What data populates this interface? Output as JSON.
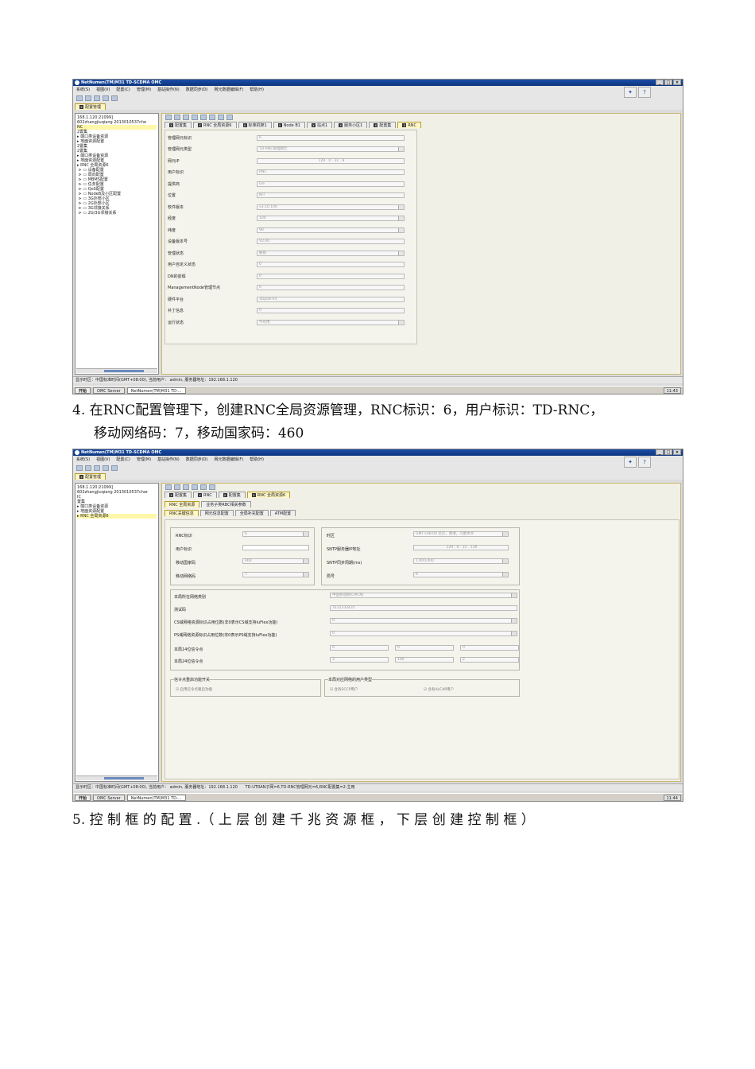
{
  "common": {
    "app_title": "NetNumen(TM)M31 TD-SCDMA OMC",
    "menu": [
      "系统(S)",
      "视图(V)",
      "配置(C)",
      "管理(M)",
      "基站操作(N)",
      "数据同步(D)",
      "网元数据编辑(F)",
      "帮助(H)"
    ],
    "window_buttons": [
      "_",
      "□",
      "×"
    ],
    "config_tab": "配置管理",
    "start": "开始",
    "taskbar_server": "OMC Server",
    "taskbar_app": "NetNumen(TM)M31 TD-...",
    "status_prefix": "显示时区：中国标准时间(GMT+08:00), 当前用户： admin, 服务器地址：192.168.1.120"
  },
  "shot1": {
    "tabs": [
      "配置集",
      "RNC 全局资源6",
      "标准机架1",
      "Node B1",
      "站点1",
      "服务小区1",
      "配置集",
      "RNC"
    ],
    "tree": [
      "168.1.120:21099]",
      "602zhangjiuqiang 2013010537che",
      "NC",
      "2置集",
      "端口类设备资源",
      "地面资源配置",
      "2置集",
      "2置集",
      "端口类设备资源",
      "地面资源配置",
      "RNC 全局资源6",
      "设备配置",
      "局向配置",
      "MBMS配置",
      "任务配置",
      "QoS配置",
      "NodeB及小区配置",
      "3G外部小区",
      "2G外部小区",
      "3G邻接关系",
      "2G/3G邻接关系"
    ],
    "fields": [
      {
        "label": "管理网元标识",
        "value": "6"
      },
      {
        "label": "管理网元类型",
        "value": "TD-RNC管理网元"
      },
      {
        "label": "网元IP",
        "value": "129 . 0 . 31 . 8"
      },
      {
        "label": "用户标识",
        "value": "RNC"
      },
      {
        "label": "提供商",
        "value": "Ele"
      },
      {
        "label": "位置",
        "value": "NIT"
      },
      {
        "label": "软件版本",
        "value": "v3.10.100"
      },
      {
        "label": "经度",
        "value": "100"
      },
      {
        "label": "纬度",
        "value": "90"
      },
      {
        "label": "设备版本号",
        "value": "V2.00"
      },
      {
        "label": "管理状态",
        "value": "解锁"
      },
      {
        "label": "用户自定义状态",
        "value": "0"
      },
      {
        "label": "DN的前缀",
        "value": "0"
      },
      {
        "label": "ManagementNode管理节点",
        "value": "0"
      },
      {
        "label": "硬件平台",
        "value": "3Gplat-V3"
      },
      {
        "label": "补丁信息",
        "value": "0"
      },
      {
        "label": "运行状态",
        "value": "不可用"
      }
    ],
    "taskbar_time": "11:43"
  },
  "caption1": {
    "line1": "4. 在RNC配置管理下，创建RNC全局资源管理，RNC标识：6，用户标识：TD-RNC，",
    "line2": "移动网络码：7，移动国家码：460"
  },
  "shot2": {
    "tabs": [
      "配置集",
      "RNC",
      "配置集",
      "RNC 全局资源6"
    ],
    "subtabs": [
      "RNC 全局资源",
      "业务子类RBC相关参数"
    ],
    "subtabs2": [
      "RNC关键信息",
      "网元信息配置",
      "全局补充配置",
      "ATM配置"
    ],
    "tree": [
      "168.1.120:21099]",
      "602zhangjiuqiang 2013010537cher",
      "IC",
      "置集",
      "端口类设备资源",
      "地面资源配置",
      "RNC 全局资源6"
    ],
    "left": [
      {
        "label": "RNC标识",
        "value": "6"
      },
      {
        "label": "用户标识",
        "value": ""
      },
      {
        "label": "移动国家码",
        "value": "460"
      },
      {
        "label": "移动网络码",
        "value": "7"
      }
    ],
    "right": [
      {
        "label": "时区",
        "value": "GMT+08:00 北京，香港，乌鲁木齐"
      },
      {
        "label": "SNTP服务器IP地址",
        "value": "129 . 0 . 31 . 139"
      },
      {
        "label": "SNTP同步周期(ms)",
        "value": "1,000,000"
      },
      {
        "label": "局号",
        "value": "6"
      }
    ],
    "mid": [
      {
        "label": "本局所在网络类别",
        "value": "中国移动网(CMCN)"
      },
      {
        "label": "测试码",
        "value": "3132333435"
      },
      {
        "label": "CS域网络资源标识占用位数(非0表示CS域支持IuFlex功能)",
        "value": "0"
      },
      {
        "label": "PS域网络资源标识占用位数(非0表示PS域支持IuFlex功能)",
        "value": "0"
      }
    ],
    "sp14": {
      "label": "本局14位信令点",
      "values": [
        "0",
        "0",
        "0"
      ]
    },
    "sp24": {
      "label": "本局24位信令点",
      "values": [
        "3",
        "100",
        "2"
      ]
    },
    "grp1": {
      "title": "信令点重启功能开关",
      "option": "启用信令点重启功能"
    },
    "grp2": {
      "title": "本局对应网络的用户类型",
      "options": [
        "含有SCCP用户",
        "含有ALCAP用户"
      ]
    },
    "status_extra": "TD-UTRAN子网=6,TD-RNC管理网元=6,RNC配置集=2:主用",
    "taskbar_time": "11:44"
  },
  "caption2": "5. 控 制 框 的 配 置 .（ 上 层 创 建 千 兆 资 源 框 ， 下 层 创 建 控 制 框 ）"
}
